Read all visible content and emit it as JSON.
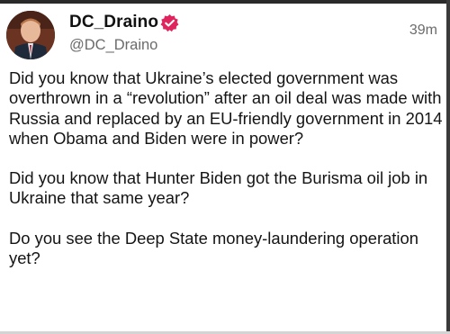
{
  "post": {
    "display_name": "DC_Draino",
    "handle": "@DC_Draino",
    "timestamp": "39m",
    "avatar_icon": "profile-photo",
    "verified_icon": "verified-badge-icon",
    "verified_color": "#e0245e",
    "paragraphs": [
      "Did you know that Ukraine’s elected government was overthrown in a “revolution” after an oil deal was made with Russia and replaced by an EU-friendly government in 2014 when Obama and Biden were in power?",
      "Did you know that Hunter Biden got the Burisma oil job in Ukraine that same year?",
      "Do you see the Deep State money-laundering operation yet?"
    ]
  }
}
